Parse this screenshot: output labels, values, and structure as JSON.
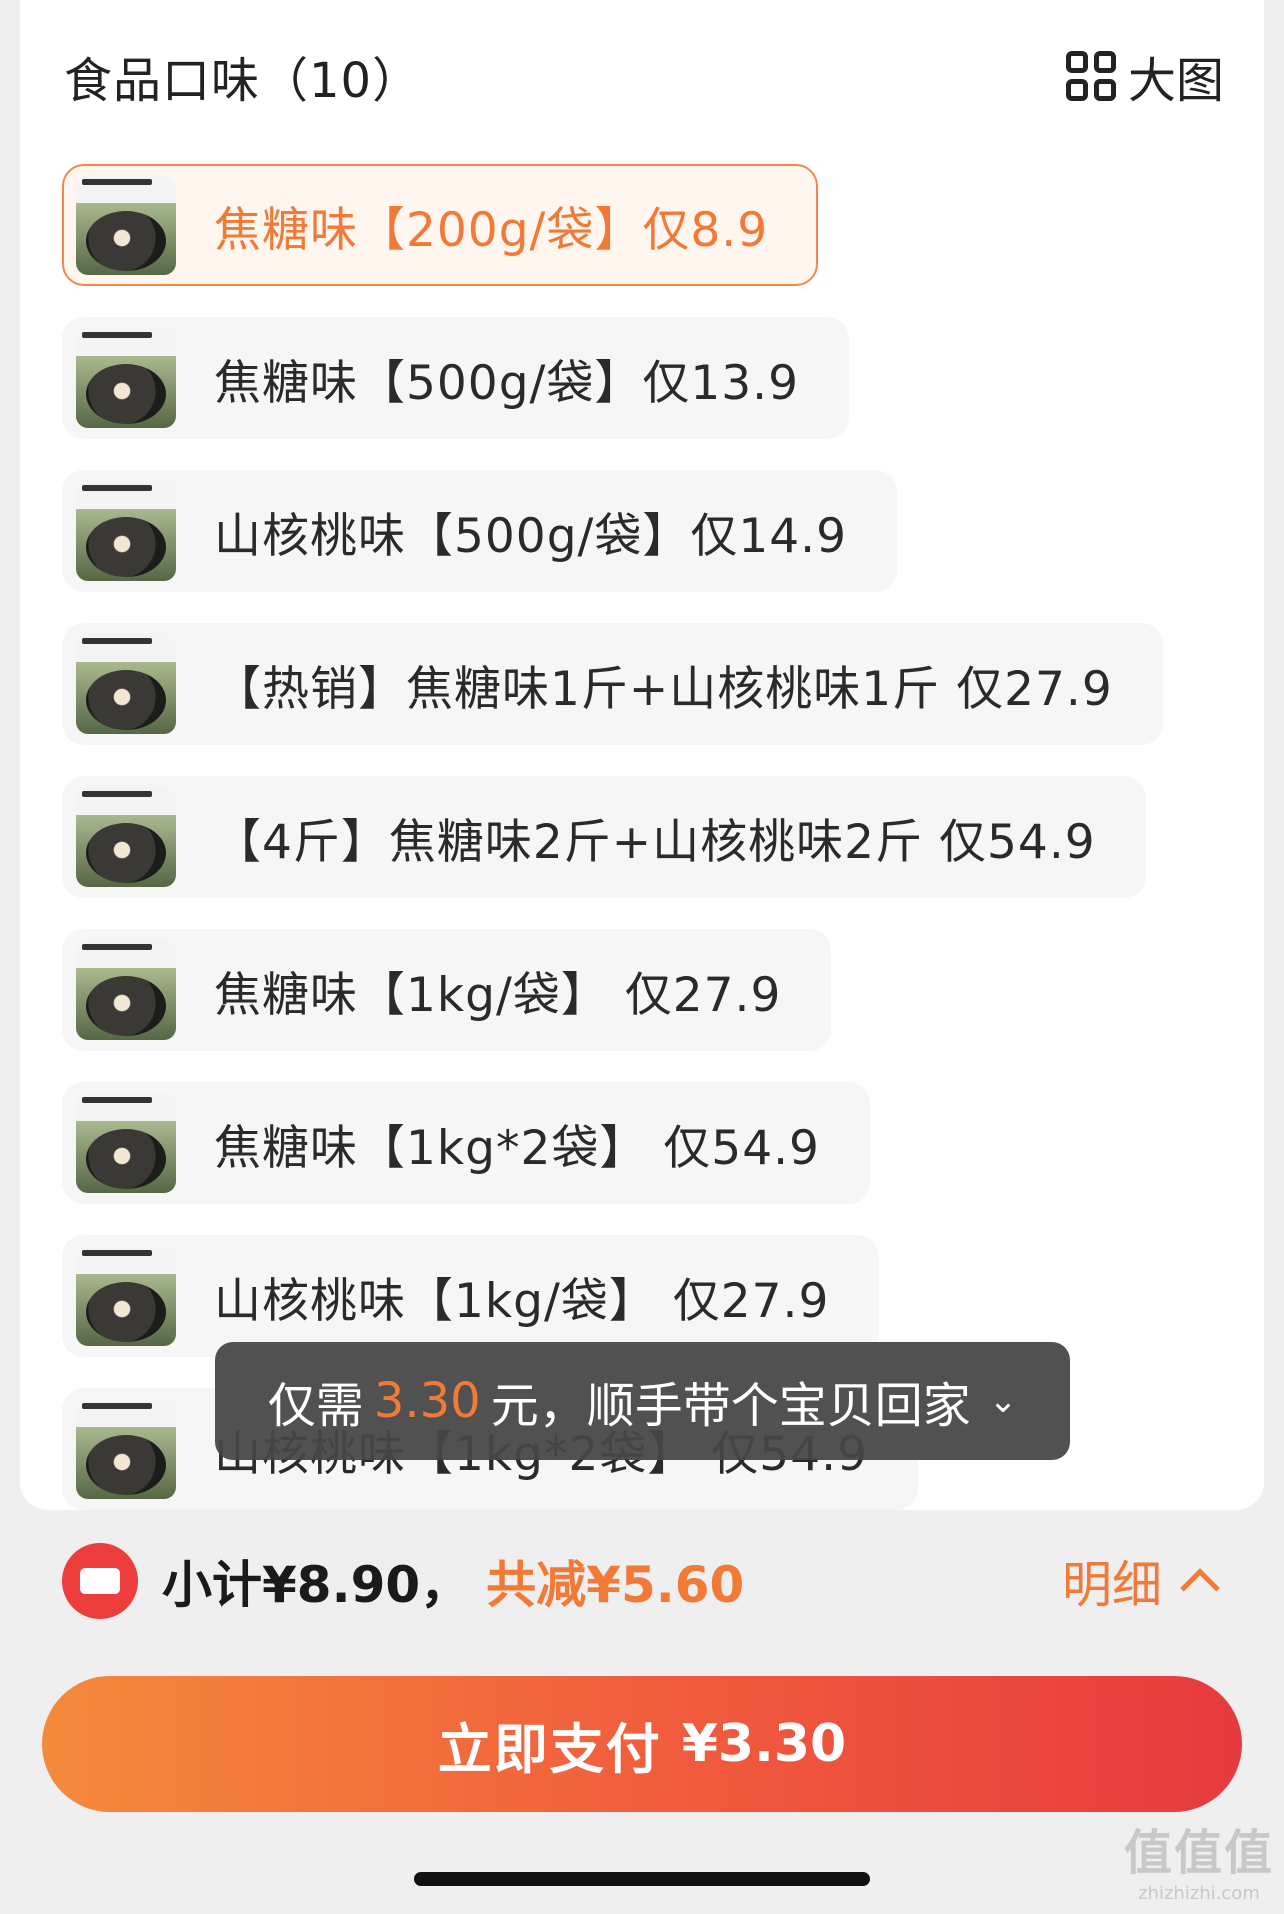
{
  "header": {
    "title": "食品口味（10）",
    "big_view_label": "大图"
  },
  "options": [
    {
      "label": "焦糖味【200g/袋】仅8.9",
      "selected": true
    },
    {
      "label": "焦糖味【500g/袋】仅13.9",
      "selected": false
    },
    {
      "label": "山核桃味【500g/袋】仅14.9",
      "selected": false
    },
    {
      "label": "【热销】焦糖味1斤+山核桃味1斤 仅27.9",
      "selected": false
    },
    {
      "label": "【4斤】焦糖味2斤+山核桃味2斤 仅54.9",
      "selected": false
    },
    {
      "label": "焦糖味【1kg/袋】 仅27.9",
      "selected": false
    },
    {
      "label": "焦糖味【1kg*2袋】 仅54.9",
      "selected": false
    },
    {
      "label": "山核桃味【1kg/袋】 仅27.9",
      "selected": false
    },
    {
      "label": "山核桃味【1kg*2袋】 仅54.9",
      "selected": false
    }
  ],
  "toast": {
    "prefix": "仅需",
    "amount": "3.30",
    "suffix": "元，顺手带个宝贝回家"
  },
  "summary": {
    "subtotal": "小计¥8.90，",
    "discount": "共减¥5.60",
    "detail_label": "明细"
  },
  "pay_button": {
    "label": "立即支付",
    "amount": "¥3.30"
  },
  "watermark": {
    "text": "值值值",
    "url": "zhizhizhi.com"
  },
  "colors": {
    "accent": "#f27a36",
    "pay_gradient_start": "#f48a3b",
    "pay_gradient_end": "#e63a3e",
    "coupon_red": "#ee3d3d"
  },
  "icons": {
    "big_view": "grid-icon",
    "coupon": "coupon-icon",
    "toast_chevron": "chevron-down-icon",
    "detail_chevron": "chevron-up-icon"
  }
}
